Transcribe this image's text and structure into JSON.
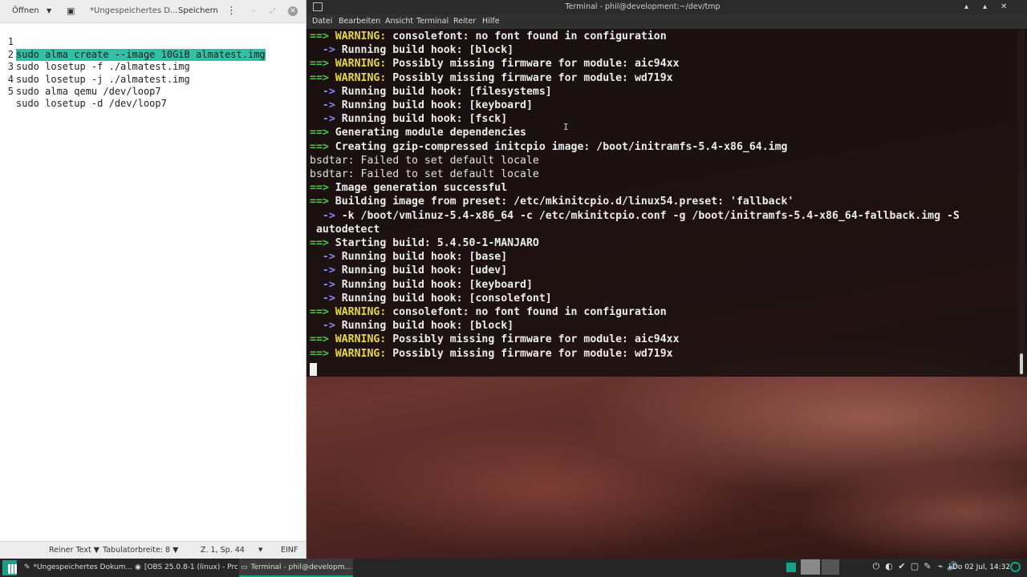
{
  "editor": {
    "toolbar": {
      "open_label": "Öffnen",
      "open_dropdown_icon": "▼",
      "new_doc_icon": "▣",
      "document_title": "*Ungespeichertes D...",
      "save_label": "Speichern",
      "menu_icon": "⋮",
      "minimize_icon": "–",
      "maximize_icon": "⤢",
      "close_icon": "✕"
    },
    "lines": [
      {
        "num": "1",
        "text": "sudo alma create --image 10GiB almatest.img"
      },
      {
        "num": "2",
        "text": "sudo losetup -f ./almatest.img"
      },
      {
        "num": "3",
        "text": "sudo losetup -j ./almatest.img"
      },
      {
        "num": "4",
        "text": "sudo alma qemu /dev/loop7"
      },
      {
        "num": "5",
        "text": "sudo losetup -d /dev/loop7"
      }
    ],
    "status": {
      "language": "Reiner Text ▼",
      "tab_width": "Tabulatorbreite: 8 ▼",
      "position": "Z. 1, Sp. 44",
      "position_arrow": "▼",
      "mode": "EINF"
    },
    "selection_color": "#33bfa6"
  },
  "terminal": {
    "window_title": "Terminal - phil@development:~/dev/tmp",
    "window_controls": {
      "minimize": "▴",
      "maximize": "▴",
      "close": "✕"
    },
    "menu": {
      "datei": "Datei",
      "bearbeiten": "Bearbeiten",
      "ansicht": "Ansicht",
      "terminal": "Terminal",
      "reiter": "Reiter",
      "hilfe": "Hilfe"
    },
    "colors": {
      "arrow_green": "#4cc94c",
      "arrow_blue": "#8a8aff",
      "warning": "#e8d840"
    },
    "lines": [
      {
        "prefix": "==> ",
        "kind": "g",
        "warn": "WARNING:",
        "rest": " consolefont: no font found in configuration"
      },
      {
        "prefix": "  -> ",
        "kind": "b",
        "warn": "",
        "rest": "Running build hook: [block]"
      },
      {
        "prefix": "==> ",
        "kind": "g",
        "warn": "WARNING:",
        "rest": " Possibly missing firmware for module: aic94xx"
      },
      {
        "prefix": "==> ",
        "kind": "g",
        "warn": "WARNING:",
        "rest": " Possibly missing firmware for module: wd719x"
      },
      {
        "prefix": "  -> ",
        "kind": "b",
        "warn": "",
        "rest": "Running build hook: [filesystems]"
      },
      {
        "prefix": "  -> ",
        "kind": "b",
        "warn": "",
        "rest": "Running build hook: [keyboard]"
      },
      {
        "prefix": "  -> ",
        "kind": "b",
        "warn": "",
        "rest": "Running build hook: [fsck]"
      },
      {
        "prefix": "==> ",
        "kind": "g",
        "warn": "",
        "rest": "Generating module dependencies"
      },
      {
        "prefix": "==> ",
        "kind": "g",
        "warn": "",
        "rest": "Creating gzip-compressed initcpio image: /boot/initramfs-5.4-x86_64.img"
      },
      {
        "prefix": "",
        "kind": "n",
        "warn": "",
        "rest": "bsdtar: Failed to set default locale"
      },
      {
        "prefix": "",
        "kind": "n",
        "warn": "",
        "rest": "bsdtar: Failed to set default locale"
      },
      {
        "prefix": "==> ",
        "kind": "g",
        "warn": "",
        "rest": "Image generation successful"
      },
      {
        "prefix": "==> ",
        "kind": "g",
        "warn": "",
        "rest": "Building image from preset: /etc/mkinitcpio.d/linux54.preset: 'fallback'"
      },
      {
        "prefix": "  -> ",
        "kind": "b",
        "warn": "",
        "rest": "-k /boot/vmlinuz-5.4-x86_64 -c /etc/mkinitcpio.conf -g /boot/initramfs-5.4-x86_64-fallback.img -S"
      },
      {
        "prefix": " ",
        "kind": "p",
        "warn": "",
        "rest": "autodetect"
      },
      {
        "prefix": "==> ",
        "kind": "g",
        "warn": "",
        "rest": "Starting build: 5.4.50-1-MANJARO"
      },
      {
        "prefix": "  -> ",
        "kind": "b",
        "warn": "",
        "rest": "Running build hook: [base]"
      },
      {
        "prefix": "  -> ",
        "kind": "b",
        "warn": "",
        "rest": "Running build hook: [udev]"
      },
      {
        "prefix": "  -> ",
        "kind": "b",
        "warn": "",
        "rest": "Running build hook: [keyboard]"
      },
      {
        "prefix": "  -> ",
        "kind": "b",
        "warn": "",
        "rest": "Running build hook: [consolefont]"
      },
      {
        "prefix": "==> ",
        "kind": "g",
        "warn": "WARNING:",
        "rest": " consolefont: no font found in configuration"
      },
      {
        "prefix": "  -> ",
        "kind": "b",
        "warn": "",
        "rest": "Running build hook: [block]"
      },
      {
        "prefix": "==> ",
        "kind": "g",
        "warn": "WARNING:",
        "rest": " Possibly missing firmware for module: aic94xx"
      },
      {
        "prefix": "==> ",
        "kind": "g",
        "warn": "WARNING:",
        "rest": " Possibly missing firmware for module: wd719x"
      }
    ]
  },
  "taskbar": {
    "tasks": [
      {
        "icon": "✎",
        "label": "*Ungespeichertes Dokum..."
      },
      {
        "icon": "◉",
        "label": "[OBS 25.0.8-1 (linux) - Pro..."
      },
      {
        "icon": "▭",
        "label": "Terminal - phil@developm..."
      }
    ],
    "tray_icons": [
      "⏻",
      "◐",
      "✔",
      "▢",
      "✎",
      "⌁",
      "🔊"
    ],
    "clock": "Do 02 Jul, 14:32",
    "accent_color": "#16a085"
  }
}
